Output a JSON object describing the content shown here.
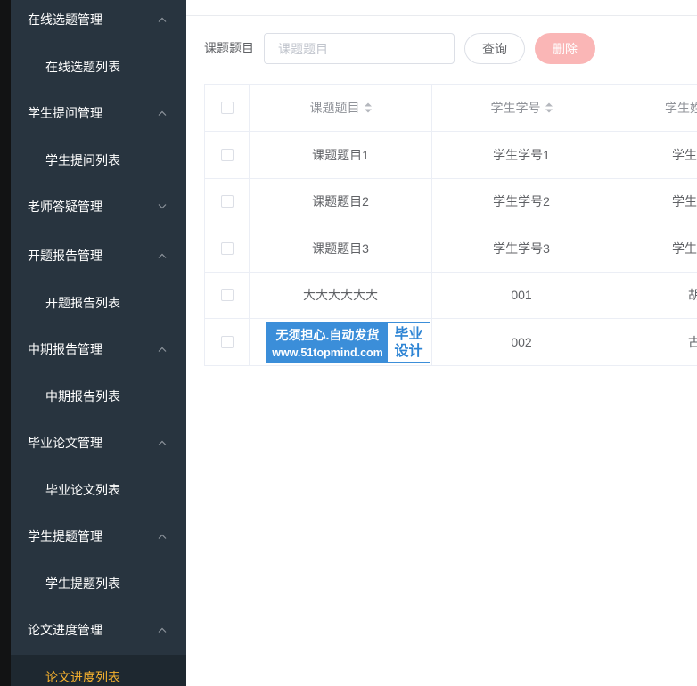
{
  "sidebar": {
    "groups": [
      {
        "title": "在线选题管理",
        "icon": "chevron-up-icon",
        "items": [
          {
            "label": "在线选题列表"
          }
        ]
      },
      {
        "title": "学生提问管理",
        "icon": "chevron-up-icon",
        "items": [
          {
            "label": "学生提问列表"
          }
        ]
      },
      {
        "title": "老师答疑管理",
        "icon": "chevron-down-icon",
        "items": []
      },
      {
        "title": "开题报告管理",
        "icon": "chevron-up-icon",
        "items": [
          {
            "label": "开题报告列表"
          }
        ]
      },
      {
        "title": "中期报告管理",
        "icon": "chevron-up-icon",
        "items": [
          {
            "label": "中期报告列表"
          }
        ]
      },
      {
        "title": "毕业论文管理",
        "icon": "chevron-up-icon",
        "items": [
          {
            "label": "毕业论文列表"
          }
        ]
      },
      {
        "title": "学生提题管理",
        "icon": "chevron-up-icon",
        "items": [
          {
            "label": "学生提题列表"
          }
        ]
      },
      {
        "title": "论文进度管理",
        "icon": "chevron-up-icon",
        "items": [
          {
            "label": "论文进度列表",
            "active": true
          }
        ]
      }
    ]
  },
  "search": {
    "label": "课题题目",
    "placeholder": "课题题目",
    "value": ""
  },
  "toolbar": {
    "query_label": "查询",
    "delete_label": "删除"
  },
  "table": {
    "columns": [
      {
        "label": "课题题目",
        "sortable": true
      },
      {
        "label": "学生学号",
        "sortable": true
      },
      {
        "label": "学生姓"
      }
    ],
    "rows": [
      {
        "topic": "课题题目1",
        "student_no": "学生学号1",
        "student_name": "学生"
      },
      {
        "topic": "课题题目2",
        "student_no": "学生学号2",
        "student_name": "学生"
      },
      {
        "topic": "课题题目3",
        "student_no": "学生学号3",
        "student_name": "学生"
      },
      {
        "topic": "大大大大大大",
        "student_no": "001",
        "student_name": "胡"
      },
      {
        "student_no": "002",
        "student_name": "古"
      }
    ]
  },
  "watermark": {
    "line1": "无须担心.自动发货",
    "line2": "www.51topmind.com",
    "badge_top": "毕业",
    "badge_bottom": "设计"
  },
  "colors": {
    "sidebar_bg": "#28343f",
    "sidebar_active_bg": "#1e2830",
    "sidebar_active_text": "#f4b02e",
    "danger_disabled": "#fab6b6",
    "watermark_blue": "#3b8ed9",
    "watermark_text": "#2d84d4"
  }
}
